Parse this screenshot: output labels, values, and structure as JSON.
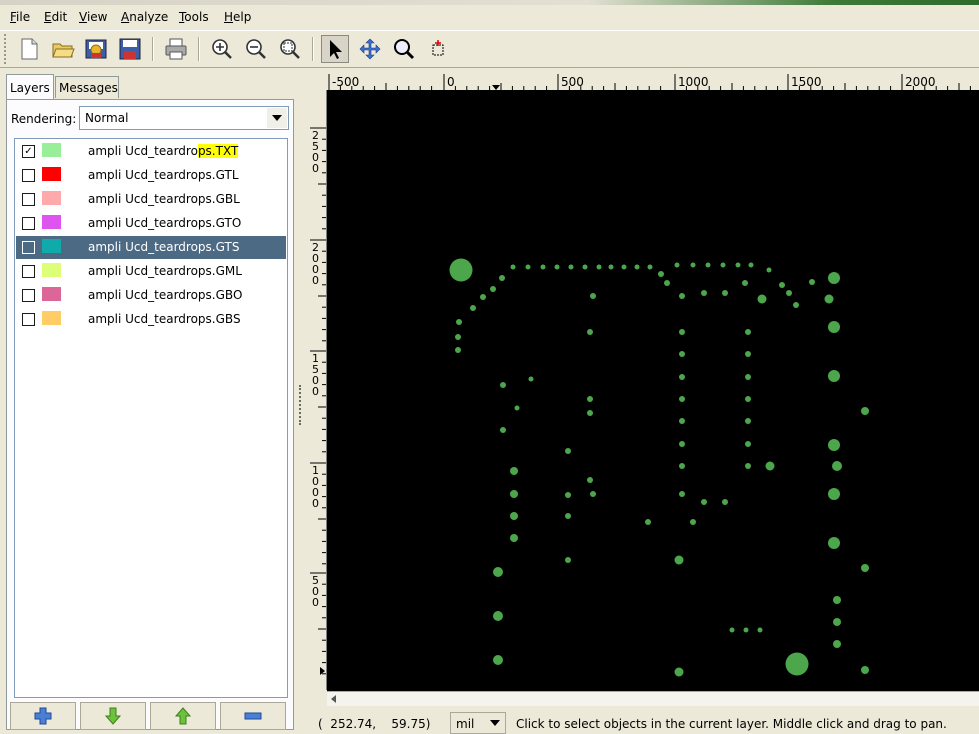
{
  "menubar": {
    "items": [
      {
        "mnemonic": "F",
        "rest": "ile"
      },
      {
        "mnemonic": "E",
        "rest": "dit"
      },
      {
        "mnemonic": "V",
        "rest": "iew"
      },
      {
        "mnemonic": "A",
        "rest": "nalyze"
      },
      {
        "mnemonic": "T",
        "rest": "ools"
      },
      {
        "mnemonic": "H",
        "rest": "elp"
      }
    ]
  },
  "tabs": {
    "layers": "Layers",
    "messages": "Messages"
  },
  "rendering": {
    "label": "Rendering:",
    "value": "Normal"
  },
  "layers": [
    {
      "prefix": "ampli Ucd_teardro",
      "highlight": "ps.TXT",
      "checked": true,
      "color": "#99ee99"
    },
    {
      "prefix": "ampli Ucd_teardrops.GTL",
      "highlight": "",
      "checked": false,
      "color": "#ff0000"
    },
    {
      "prefix": "ampli Ucd_teardrops.GBL",
      "highlight": "",
      "checked": false,
      "color": "#ffaaaa"
    },
    {
      "prefix": "ampli Ucd_teardrops.GTO",
      "highlight": "",
      "checked": false,
      "color": "#dd55ee"
    },
    {
      "prefix": "ampli Ucd_teardrops.GTS",
      "highlight": "",
      "checked": false,
      "color": "#11aaaa",
      "selected": true
    },
    {
      "prefix": "ampli Ucd_teardrops.GML",
      "highlight": "",
      "checked": false,
      "color": "#ddff77"
    },
    {
      "prefix": "ampli Ucd_teardrops.GBO",
      "highlight": "",
      "checked": false,
      "color": "#dd6699"
    },
    {
      "prefix": "ampli Ucd_teardrops.GBS",
      "highlight": "",
      "checked": false,
      "color": "#ffcc66"
    }
  ],
  "rulers": {
    "horizontal": [
      "-500",
      "0",
      "500",
      "1000",
      "1500",
      "2000"
    ],
    "vertical": [
      "2500",
      "2000",
      "1500",
      "1000",
      "500"
    ]
  },
  "status": {
    "coords": "(  252.74,    59.75)",
    "unit": "mil",
    "message": "Click to select objects in the current layer. Middle click and drag to pan."
  },
  "colors": {
    "pad": "#4ca64c",
    "canvas_bg": "#000000",
    "selection": "#4d6a85"
  }
}
